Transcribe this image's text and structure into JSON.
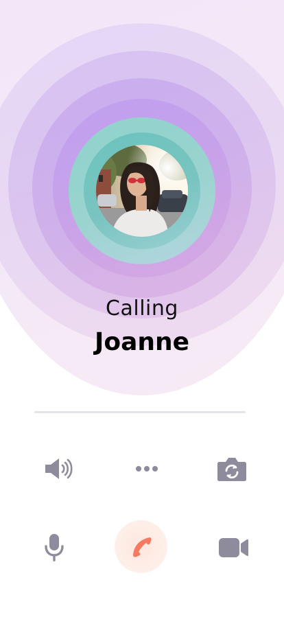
{
  "call": {
    "status": "Calling",
    "contact_name": "Joanne"
  },
  "colors": {
    "icon_gray": "#8e8c9c",
    "end_call_accent": "#f57a62",
    "ring_teal": "#79c4c0",
    "ring_purple": "#c9a3e8"
  },
  "controls": {
    "row1": [
      "speaker-icon",
      "more-icon",
      "switch-camera-icon"
    ],
    "row2": [
      "microphone-icon",
      "end-call-icon",
      "video-camera-icon"
    ]
  }
}
